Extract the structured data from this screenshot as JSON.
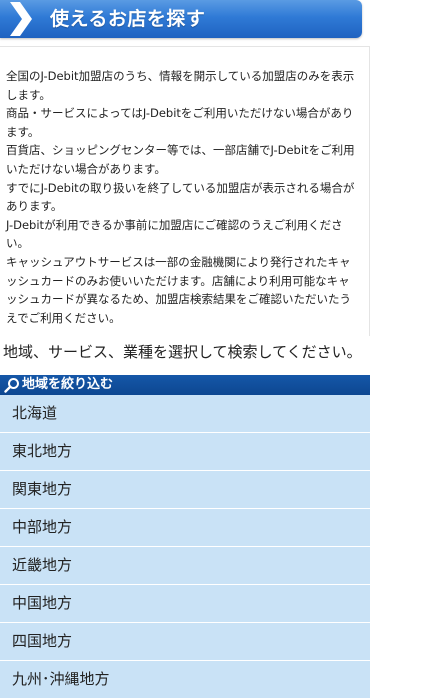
{
  "header": {
    "title": "使えるお店を探す"
  },
  "notice": {
    "paragraphs": [
      "全国のJ-Debit加盟店のうち、情報を開示している加盟店のみを表示します。",
      "商品・サービスによってはJ-Debitをご利用いただけない場合があります。",
      "百貨店、ショッピングセンター等では、一部店舗でJ-Debitをご利用いただけない場合があります。",
      "すでにJ-Debitの取り扱いを終了している加盟店が表示される場合があります。",
      "J-Debitが利用できるか事前に加盟店にご確認のうえご利用ください。",
      "キャッシュアウトサービスは一部の金融機関により発行されたキャッシュカードのみお使いいただけます。店舗により利用可能なキャッシュカードが異なるため、加盟店検索結果をご確認いただいたうえでご利用ください。"
    ]
  },
  "lead_text": "地域、サービス、業種を選択して検索してください。",
  "region_filter": {
    "title": "地域を絞り込む",
    "regions": [
      "北海道",
      "東北地方",
      "関東地方",
      "中部地方",
      "近畿地方",
      "中国地方",
      "四国地方",
      "九州･沖縄地方"
    ]
  },
  "colors": {
    "banner": "#2f7ad6",
    "filter_header": "#0d4791",
    "region_item": "#c9e2f6"
  }
}
